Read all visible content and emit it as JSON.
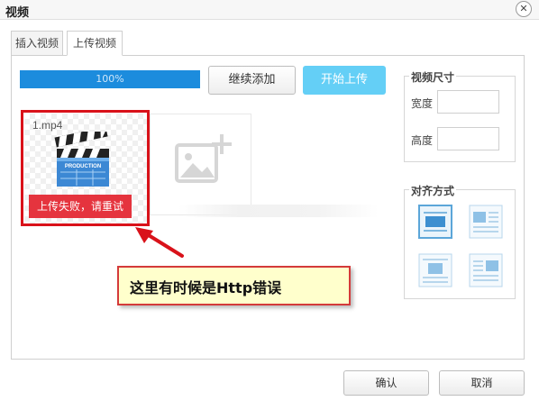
{
  "window": {
    "title": "视频"
  },
  "tabs": [
    {
      "label": "插入视频",
      "active": false
    },
    {
      "label": "上传视频",
      "active": true
    }
  ],
  "upload": {
    "progress_percent": 100,
    "progress_text": "100%",
    "continue_add_label": "继续添加",
    "start_upload_label": "开始上传"
  },
  "file": {
    "name": "1.mp4",
    "clapboard_text": "PRODUCTION",
    "status": "上传失败，请重试"
  },
  "annotation": {
    "text": "这里有时候是Http错误"
  },
  "size": {
    "legend": "视频尺寸",
    "width_label": "宽度",
    "width_value": "",
    "height_label": "高度",
    "height_value": ""
  },
  "align": {
    "legend": "对齐方式",
    "options": [
      "none-align-icon",
      "left-align-icon",
      "center-align-icon",
      "right-align-icon"
    ],
    "selected_index": 0
  },
  "footer": {
    "ok_label": "确认",
    "cancel_label": "取消"
  },
  "colors": {
    "progress": "#1c8cdd",
    "upload_button": "#64cff6",
    "fail": "#e5343e",
    "highlight": "#d9121a",
    "callout_bg": "#ffffcc"
  }
}
